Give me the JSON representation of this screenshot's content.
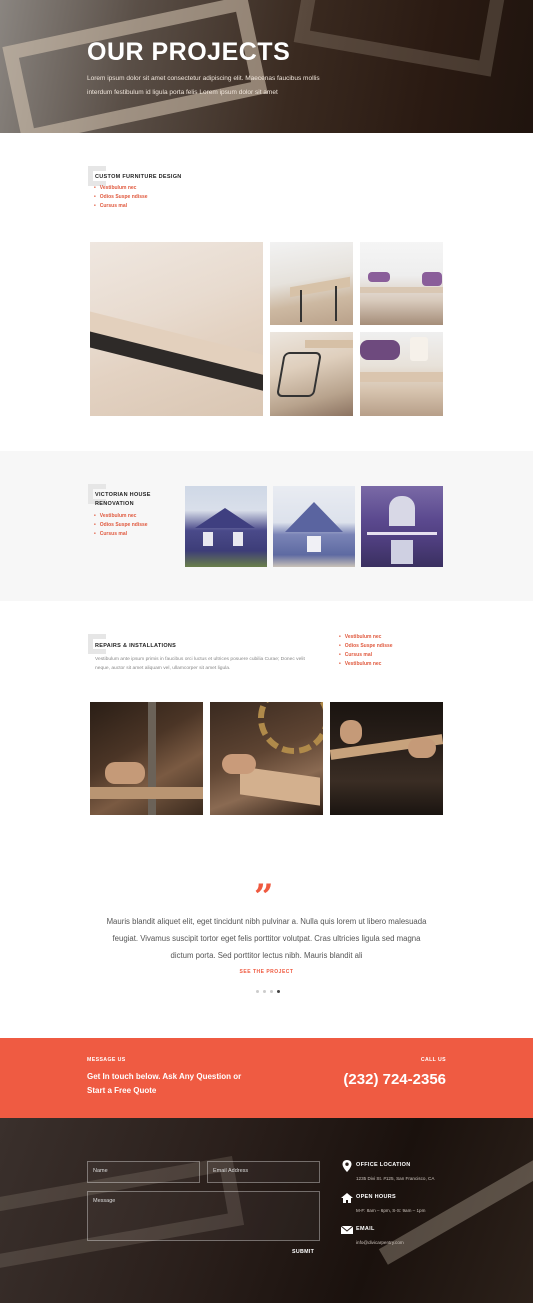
{
  "hero": {
    "title": "OUR PROJECTS",
    "subtitle": "Lorem ipsum dolor sit amet consectetur adipiscing elit. Maecenas faucibus mollis interdum festibulum id ligula porta felis Lorem ipsum dolor sit amet"
  },
  "project1": {
    "title": "CUSTOM FURNITURE DESIGN",
    "bullets": [
      "Vestibulum nec",
      "Odios Suspe ndisse",
      "Cursus mal"
    ]
  },
  "project2": {
    "title_line1": "VICTORIAN HOUSE",
    "title_line2": "RENOVATION",
    "bullets": [
      "Vestibulum nec",
      "Odios Suspe ndisse",
      "Cursus mal"
    ]
  },
  "project3": {
    "title": "REPAIRS & INSTALLATIONS",
    "description": "Vestibulum ante ipsum primis in faucibus orci luctus et ultrices posuere cubilia Curae; Donec velit neque, auctor sit amet aliquam vel, ullamcorper sit amet ligula.",
    "bullets": [
      "Vestibulum nec",
      "Odios Suspe ndisse",
      "Cursus mal",
      "Vestibulum nec"
    ]
  },
  "testimonial": {
    "quote_mark": "”",
    "text": "Mauris blandit aliquet elit, eget tincidunt nibh pulvinar a. Nulla quis lorem ut libero malesuada feugiat. Vivamus suscipit tortor eget felis porttitor volutpat. Cras ultricies ligula sed magna dictum porta. Sed porttitor lectus nibh. Mauris blandit ali",
    "link": "SEE THE PROJECT",
    "slides": 4,
    "active_slide": 4
  },
  "cta": {
    "label": "MESSAGE US",
    "heading_line1": "Get In touch below. Ask Any Question or",
    "heading_line2": "Start a Free Quote",
    "call_label": "CALL US",
    "phone": "(232) 724-2356"
  },
  "form": {
    "name_placeholder": "Name",
    "email_placeholder": "Email Address",
    "message_placeholder": "Message",
    "submit": "SUBMIT"
  },
  "contact": {
    "office_title": "OFFICE LOCATION",
    "office_value": "1235 Divi St. #125, San Francisco, CA",
    "hours_title": "OPEN HOURS",
    "hours_value": "M-F: 8am – 6pm, S-S: 9am – 1pm",
    "email_title": "EMAIL",
    "email_value": "info@divicarpentry.com"
  },
  "colors": {
    "accent": "#ef5b42",
    "dark": "#222222"
  },
  "icons": [
    "location-pin-icon",
    "house-icon",
    "envelope-icon",
    "quote-icon"
  ]
}
